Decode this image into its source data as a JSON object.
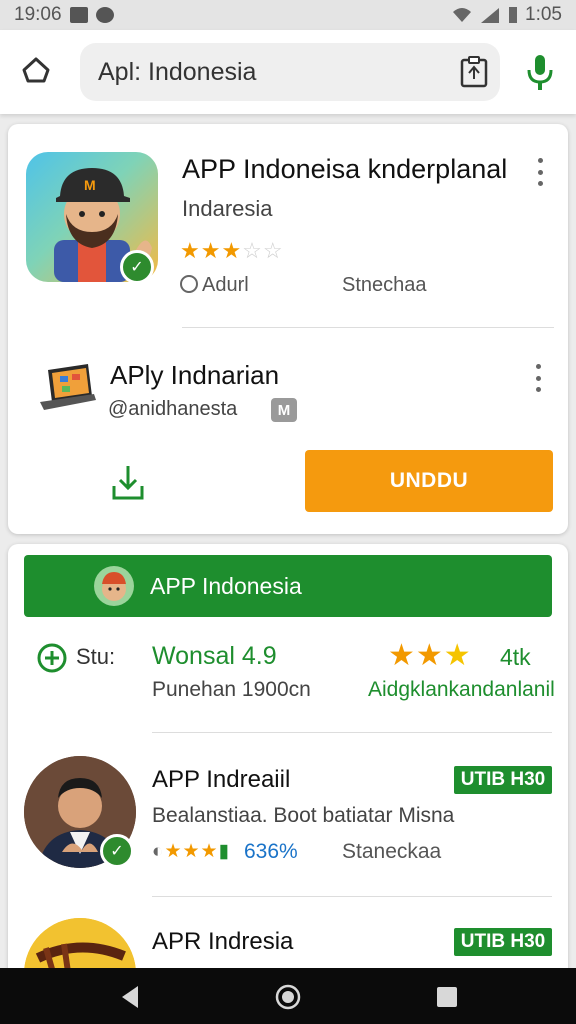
{
  "status_bar": {
    "time_left": "19:06",
    "time_right": "1:05"
  },
  "search": {
    "query": "Apl: Indonesia"
  },
  "featured": {
    "title": "APP Indoneisa knderplanal",
    "subtitle": "Indaresia",
    "rating_stars": 3,
    "meta_left": "Adurl",
    "meta_right": "Stnechaa"
  },
  "secondary": {
    "title": "APly Indnarian",
    "developer": "@anidhanesta",
    "badge": "M"
  },
  "install_button_label": "UNDDU",
  "banner": {
    "label": "APP Indonesia"
  },
  "stats": {
    "left_label": "Stu:",
    "center_label": "Wonsal 4.9",
    "rating_stars": 3,
    "rating_text": "4tk",
    "line2_left": "Punehan 1900cn",
    "line2_right": "Aidgklankandanlanil"
  },
  "list": [
    {
      "title": "APP Indreaiil",
      "tag": "UTIB H30",
      "description": "Bealanstiaa. Boot batiatar Misna",
      "percent": "636%",
      "meta": "Staneckaa"
    },
    {
      "title": "APR Indresia",
      "tag": "UTIB H30"
    }
  ],
  "colors": {
    "accent_orange": "#f59a0e",
    "brand_green": "#1e8e2e",
    "star": "#f29900"
  }
}
